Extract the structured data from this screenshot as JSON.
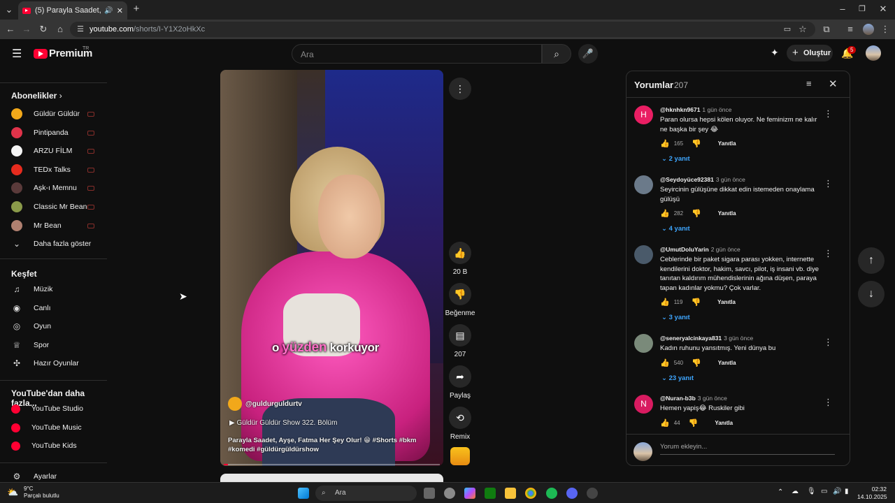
{
  "browser": {
    "tab_title": "(5) Parayla Saadet, Ayşe, Fa",
    "url_host": "youtube.com",
    "url_path": "/shorts/I-Y1X2oHkXc"
  },
  "header": {
    "logo_text": "Premium",
    "logo_region": "TR",
    "search_placeholder": "Ara",
    "create_label": "Oluştur",
    "notif_count": "5"
  },
  "sidebar": {
    "subs_heading": "Abonelikler",
    "subscriptions": [
      {
        "label": "Güldür Güldür",
        "color": "#f2a81a"
      },
      {
        "label": "Pintipanda",
        "color": "#e0334a"
      },
      {
        "label": "ARZU FİLM",
        "color": "#f4f4f4"
      },
      {
        "label": "TEDx Talks",
        "color": "#e62b1e"
      },
      {
        "label": "Aşk-ı Memnu",
        "color": "#5a3a3a"
      },
      {
        "label": "Classic Mr Bean",
        "color": "#8a9a4a"
      },
      {
        "label": "Mr Bean",
        "color": "#b08070"
      }
    ],
    "show_more": "Daha fazla göster",
    "explore_heading": "Keşfet",
    "explore": [
      {
        "label": "Müzik",
        "icon": "music-icon"
      },
      {
        "label": "Canlı",
        "icon": "live-icon"
      },
      {
        "label": "Oyun",
        "icon": "gaming-icon"
      },
      {
        "label": "Spor",
        "icon": "trophy-icon"
      },
      {
        "label": "Hazır Oyunlar",
        "icon": "playables-icon"
      }
    ],
    "more_heading": "YouTube'dan daha fazla...",
    "more": [
      {
        "label": "YouTube Studio"
      },
      {
        "label": "YouTube Music"
      },
      {
        "label": "YouTube Kids"
      }
    ],
    "settings": "Ayarlar"
  },
  "video": {
    "caption_pre": "o",
    "caption_highlight": "yüzden",
    "caption_post": "korkuyor",
    "channel": "@guldurguldurtv",
    "playlist": "Güldür Güldür Show 322. Bölüm",
    "title": "Parayla Saadet, Ayşe, Fatma Her Şey Olur! 😁 #Shorts #bkm #komedi #güldürgüldürshow",
    "progress": 0.02
  },
  "actions": {
    "like_count": "20 B",
    "dislike_label": "Beğenme",
    "comment_count": "207",
    "share_label": "Paylaş",
    "remix_label": "Remix"
  },
  "comments": {
    "title": "Yorumlar",
    "count": "207",
    "add_placeholder": "Yorum ekleyin...",
    "reply_label": "Yanıtla",
    "items": [
      {
        "initial": "H",
        "avatar_color": "#e91e63",
        "user": "@hknhkn9671",
        "time": "1 gün önce",
        "text": "Paran olursa hepsi kölen oluyor. Ne feminizm ne kalır ne başka bir şey 😂",
        "likes": "165",
        "replies": "2 yanıt"
      },
      {
        "initial": "",
        "avatar_color": "#6b7a8a",
        "user": "@Seydoyüce92381",
        "time": "3 gün önce",
        "text": "Seyircinin gülüşüne dikkat edin istemeden onaylama gülüşü",
        "likes": "282",
        "replies": "4 yanıt"
      },
      {
        "initial": "",
        "avatar_color": "#4a5a6a",
        "user": "@UmutDoluYarin",
        "time": "2 gün önce",
        "text": "Ceblerinde bir paket sigara parası yokken, internette kendilerini doktor, hakim, savcı, pilot, iş insani vb. diye tanıtan kaldırım mühendislerinin ağına düşen, paraya tapan kadınlar yokmu? Çok varlar.",
        "likes": "119",
        "replies": "3 yanıt"
      },
      {
        "initial": "",
        "avatar_color": "#7a8a7a",
        "user": "@seneryalcinkaya831",
        "time": "3 gün önce",
        "text": "Kadın ruhunu yansıtmış. Yeni dünya bu",
        "likes": "540",
        "replies": "23 yanıt"
      },
      {
        "initial": "N",
        "avatar_color": "#d81b60",
        "user": "@Nuran-b3b",
        "time": "3 gün önce",
        "text": "Hemen yapiş😂 Ruskiler gibi",
        "likes": "44",
        "replies": ""
      }
    ]
  },
  "taskbar": {
    "weather_temp": "9°C",
    "weather_desc": "Parçalı bulutlu",
    "search": "Ara",
    "time": "02:32",
    "date": "14.10.2025"
  }
}
